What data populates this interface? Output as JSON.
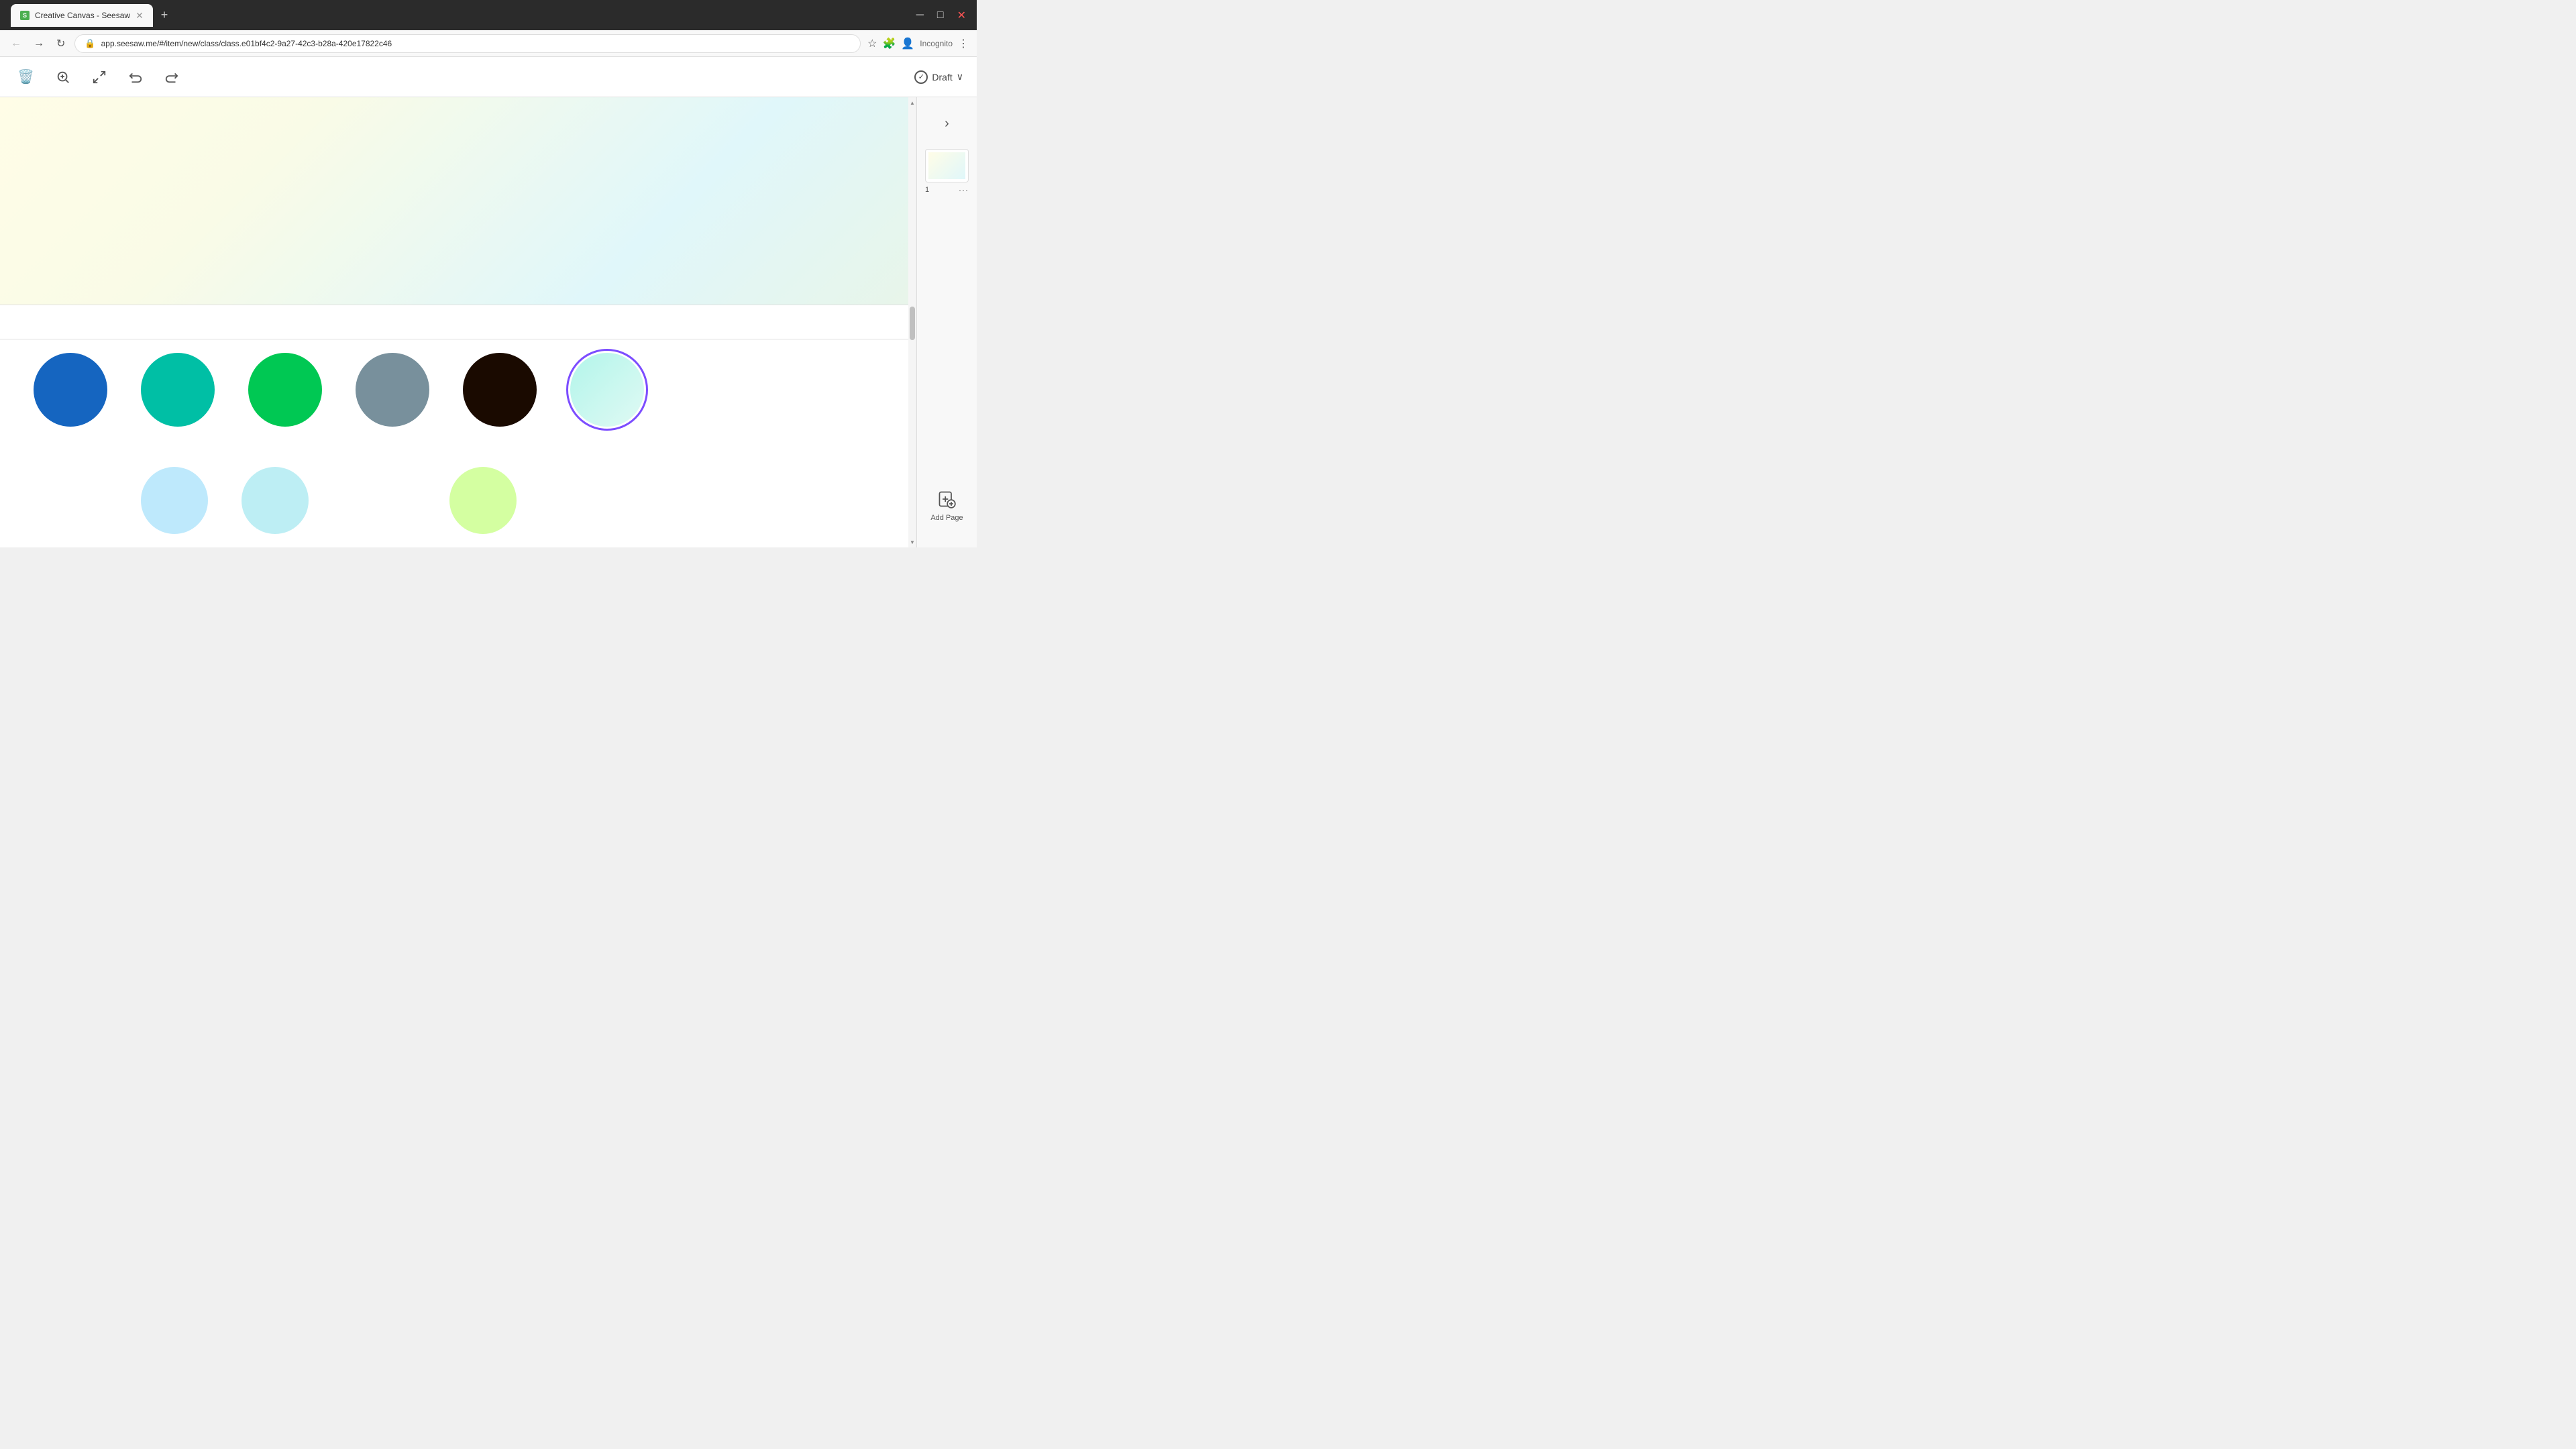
{
  "browser": {
    "tab_title": "Creative Canvas - Seesaw",
    "tab_favicon_text": "S",
    "url": "app.seesaw.me/#/item/new/class/class.e01bf4c2-9a27-42c3-b28a-420e17822c46",
    "incognito_label": "Incognito",
    "new_tab_icon": "+",
    "window_minimize": "─",
    "window_restore": "□",
    "window_close": "✕"
  },
  "toolbar": {
    "delete_icon": "🗑",
    "zoom_in_icon": "⊕",
    "fullscreen_icon": "⛶",
    "undo_icon": "↩",
    "redo_icon": "↪",
    "draft_label": "Draft",
    "draft_dropdown_icon": "∨"
  },
  "canvas": {
    "gradient_colors": {
      "top_left": "#fffde7",
      "top_right": "#fffff0",
      "bottom_left": "#e8f5e9",
      "bottom_right": "#e0f7fa"
    }
  },
  "color_circles": [
    {
      "id": "blue",
      "color": "#1565c0",
      "size": 110,
      "selected": false
    },
    {
      "id": "teal",
      "color": "#00bfa5",
      "size": 110,
      "selected": false
    },
    {
      "id": "green",
      "color": "#00c853",
      "size": 110,
      "selected": false
    },
    {
      "id": "gray",
      "color": "#78909c",
      "size": 110,
      "selected": false
    },
    {
      "id": "dark-brown",
      "color": "#1a0a00",
      "size": 110,
      "selected": false
    },
    {
      "id": "mint",
      "color": "#b2f5ea",
      "size": 110,
      "selected": true
    }
  ],
  "color_circles_row2": [
    {
      "id": "light-blue",
      "color": "#b3e5fc",
      "size": 100,
      "opacity": 0.7
    },
    {
      "id": "light-cyan",
      "color": "#b2ebf2",
      "size": 100,
      "opacity": 0.7
    },
    {
      "id": "light-green",
      "color": "#ccff90",
      "size": 100,
      "opacity": 0.7
    }
  ],
  "sidebar": {
    "expand_icon": "›",
    "page_number": "1",
    "page_more_icon": "···",
    "add_page_label": "Add Page"
  },
  "nav": {
    "back_icon": "←",
    "forward_icon": "→",
    "refresh_icon": "↻"
  }
}
